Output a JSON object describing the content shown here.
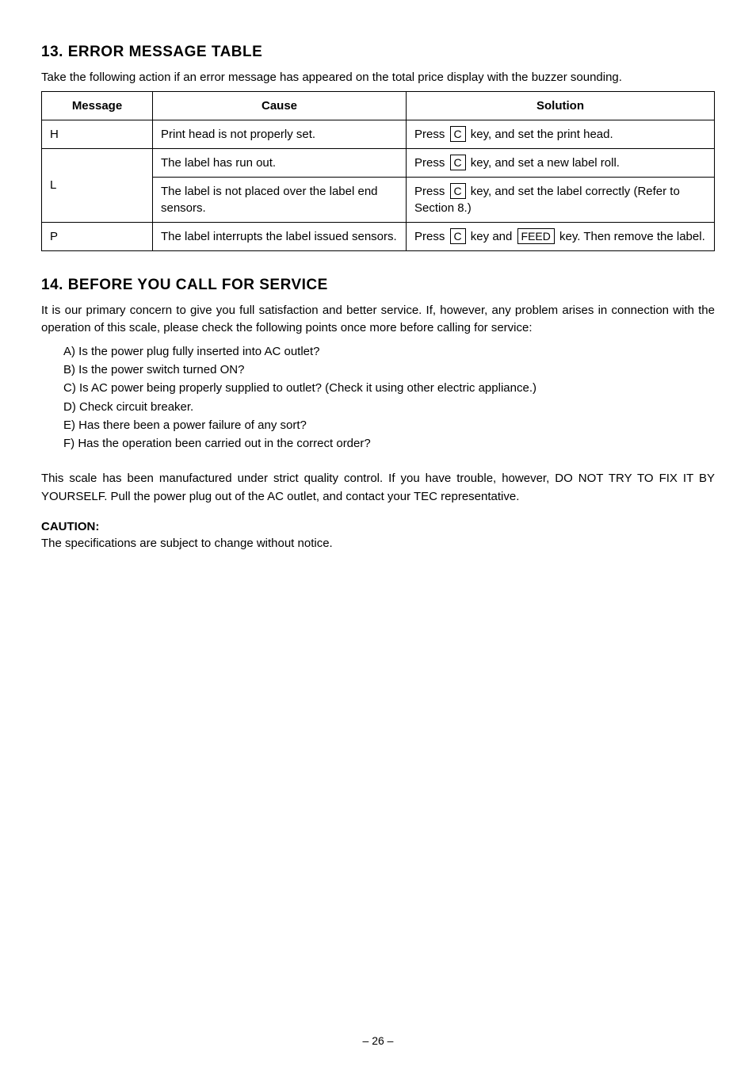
{
  "sections": {
    "error_table": {
      "heading": "13. ERROR MESSAGE TABLE",
      "intro": "Take the following action if an error message has appeared on the total price display with the buzzer sounding.",
      "headers": {
        "message": "Message",
        "cause": "Cause",
        "solution": "Solution"
      },
      "rows": {
        "h": {
          "message": "H",
          "cause": "Print head is not properly set.",
          "solution_pre": "Press ",
          "solution_key1": "C",
          "solution_post": " key, and set the print head."
        },
        "l1": {
          "cause": "The label has run out.",
          "solution_pre": "Press ",
          "solution_key1": "C",
          "solution_post": " key, and set a new label roll."
        },
        "l_message": "L",
        "l2": {
          "cause": "The label is not placed over the label end sensors.",
          "solution_pre": "Press ",
          "solution_key1": "C",
          "solution_post": " key, and set the label correctly (Refer to Section 8.)"
        },
        "p": {
          "message": "P",
          "cause": "The label interrupts the label issued sensors.",
          "solution_pre": "Press ",
          "solution_key1": "C",
          "solution_mid": " key and ",
          "solution_key2": "FEED",
          "solution_post": " key. Then remove the label."
        }
      }
    },
    "before_service": {
      "heading": "14. BEFORE YOU CALL FOR SERVICE",
      "intro": "It is our primary concern to give you full satisfaction and better service. If, however, any problem arises in connection with the operation of this scale, please check the following points once more before calling for service:",
      "items": {
        "a": "A)  Is the power plug fully inserted into AC outlet?",
        "b": "B)  Is the power switch turned ON?",
        "c": "C)  Is AC power being properly supplied to outlet? (Check it using other electric appliance.)",
        "d": "D)  Check circuit breaker.",
        "e": "E)  Has there been a power failure of any sort?",
        "f": "F)  Has the operation been carried out in the correct order?"
      },
      "closing": "This scale has been manufactured under strict quality control. If you have trouble, however, DO NOT TRY TO FIX IT BY YOURSELF. Pull the power plug out of the AC outlet, and contact your TEC representative.",
      "caution_label": "CAUTION:",
      "caution_text": "The specifications are subject to change without notice."
    }
  },
  "page_number": "– 26 –"
}
